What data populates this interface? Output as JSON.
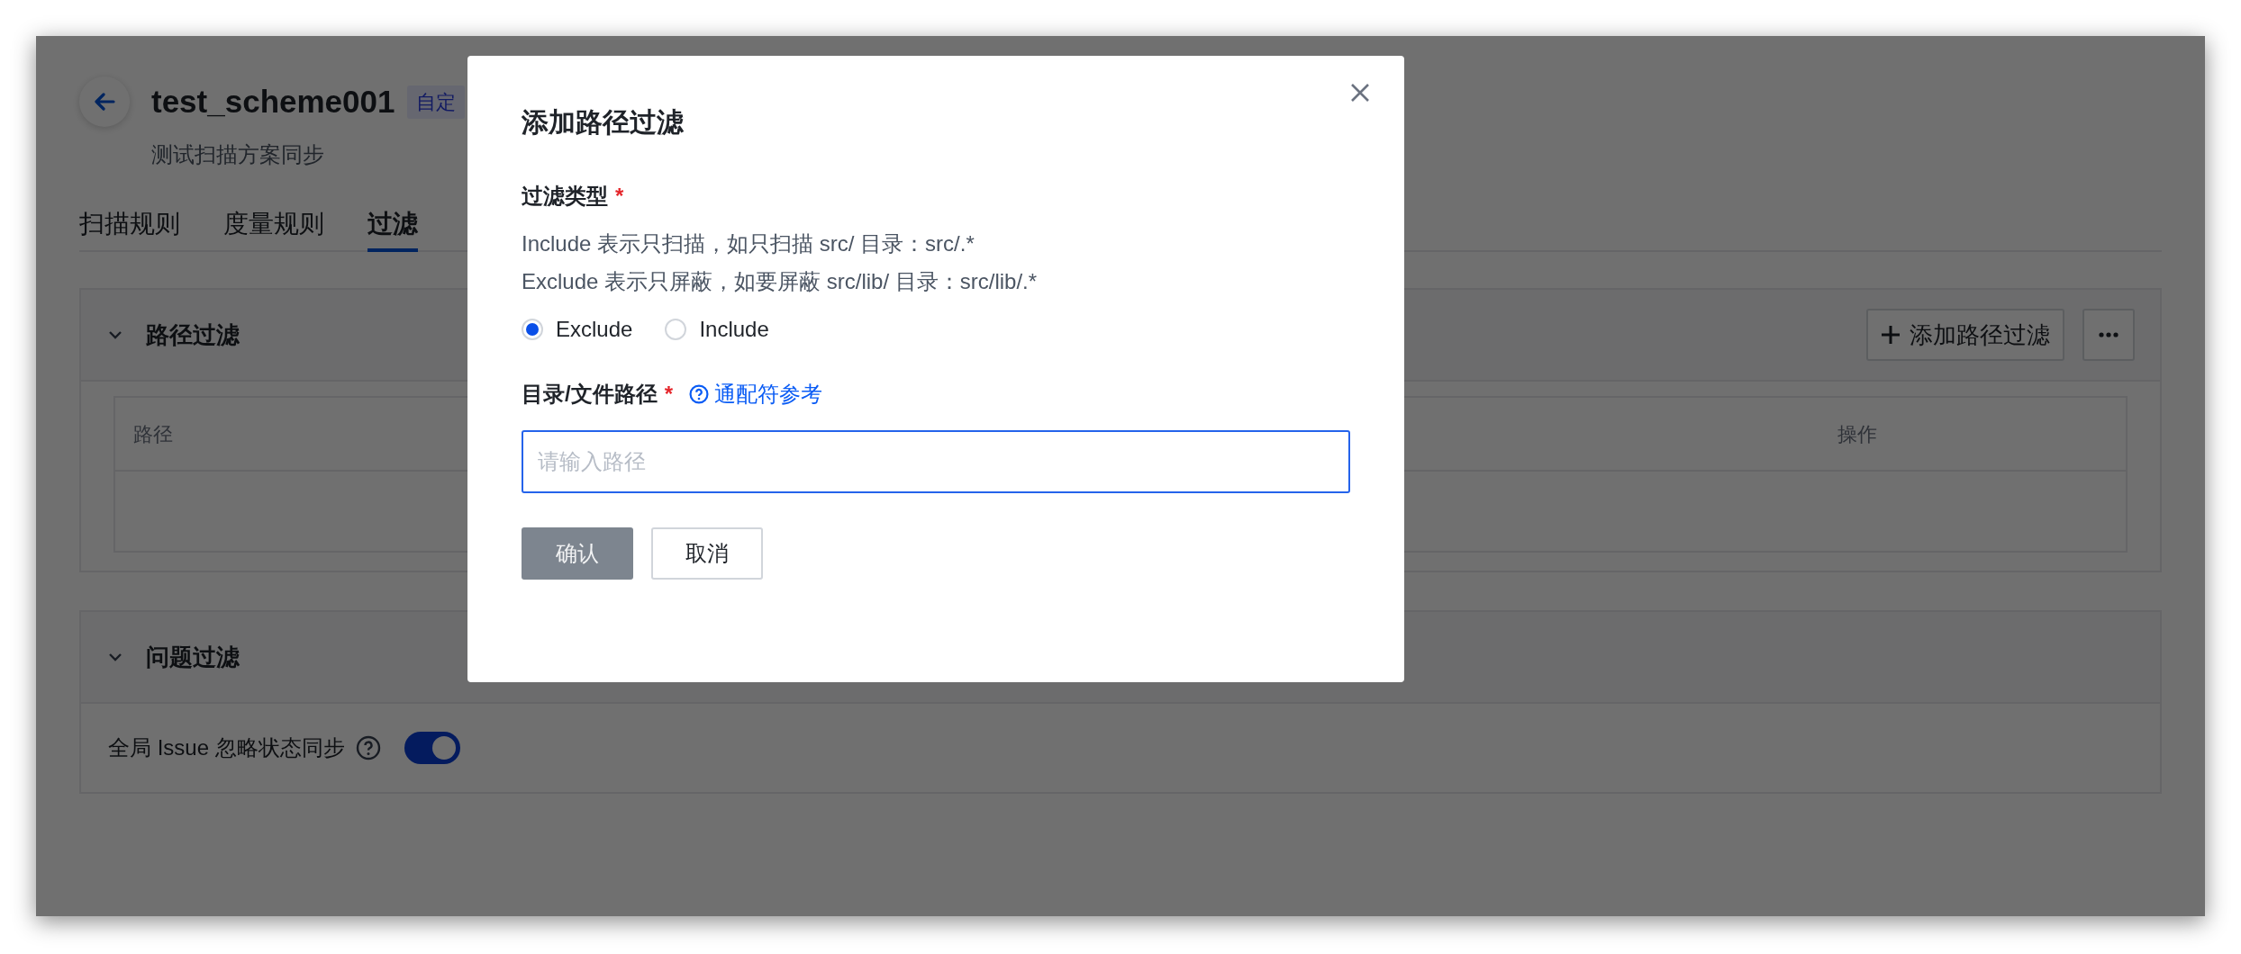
{
  "page": {
    "title": "test_scheme001",
    "badge": "自定",
    "subtitle": "测试扫描方案同步"
  },
  "tabs": [
    {
      "label": "扫描规则",
      "selected": false
    },
    {
      "label": "度量规则",
      "selected": false
    },
    {
      "label": "过滤",
      "selected": true
    }
  ],
  "sections": [
    {
      "kind": "table",
      "title": "路径过滤",
      "expanded": true,
      "add_button": "添加路径过滤",
      "columns": [
        "路径",
        "操作"
      ]
    },
    {
      "kind": "settings",
      "title": "问题过滤",
      "expanded": true,
      "settings": [
        {
          "label": "全局 Issue 忽略状态同步",
          "on": true
        }
      ]
    }
  ],
  "dialog": {
    "title": "添加路径过滤",
    "fields": [
      {
        "kind": "radio",
        "label": "过滤类型",
        "required_mark": "*",
        "description": [
          "Include 表示只扫描，如只扫描 src/ 目录：src/.*",
          "Exclude 表示只屏蔽，如要屏蔽 src/lib/ 目录：src/lib/.*"
        ],
        "options": [
          {
            "label": "Exclude",
            "selected": true
          },
          {
            "label": "Include",
            "selected": false
          }
        ]
      },
      {
        "kind": "input",
        "label": "目录/文件路径",
        "required_mark": "*",
        "help_link": "通配符参考",
        "placeholder": "请输入路径",
        "focused": true
      }
    ],
    "buttons": [
      {
        "label": "确认",
        "kind": "primary",
        "disabled": true
      },
      {
        "label": "取消",
        "kind": "secondary",
        "disabled": false
      }
    ]
  }
}
